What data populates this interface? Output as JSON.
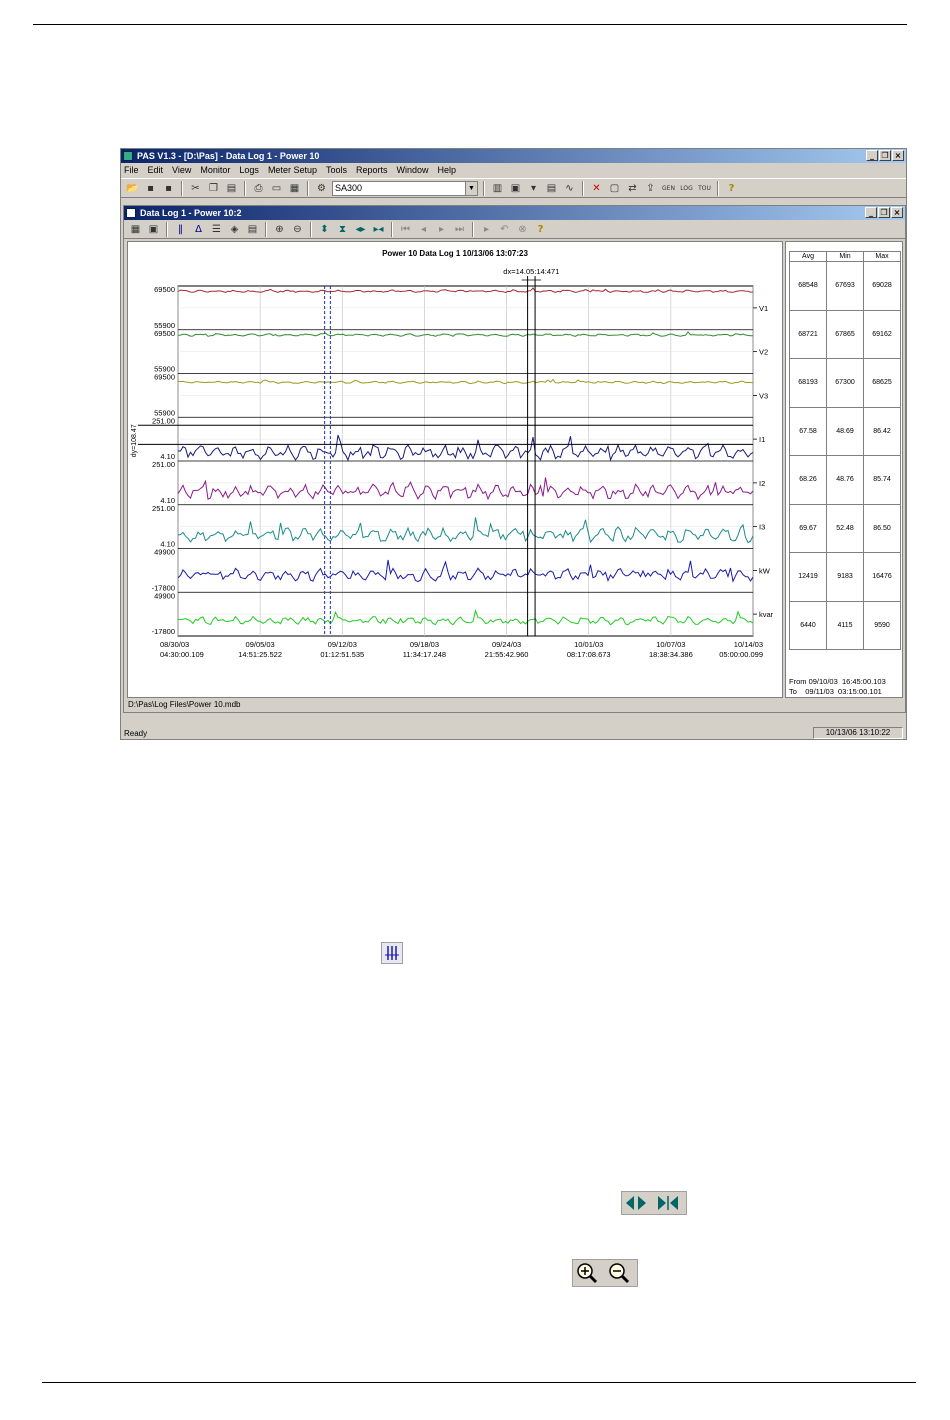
{
  "app": {
    "title": "PAS V1.3 - [D:\\Pas] - Data Log 1 - Power 10",
    "window_buttons": [
      "_",
      "❐",
      "×"
    ],
    "menu": [
      "File",
      "Edit",
      "View",
      "Monitor",
      "Logs",
      "Meter Setup",
      "Tools",
      "Reports",
      "Window",
      "Help"
    ],
    "site_combo": "SA300",
    "toolbar_icons": [
      "open-icon",
      "save-icon",
      "save-all-icon",
      "cut-icon",
      "copy-icon",
      "paste-icon",
      "print-icon",
      "preview-icon",
      "properties-icon",
      "connect-icon"
    ],
    "toolbar2_icons": [
      "table-icon",
      "monitor-icon",
      "download-icon",
      "chart-icon",
      "waveform-icon",
      "delete-icon",
      "stop-icon",
      "transfer-icon",
      "upload-icon",
      "gen-report-icon",
      "log-report-icon",
      "tou-report-icon",
      "help-icon"
    ],
    "report_labels": [
      "GEN",
      "LOG",
      "TOU"
    ],
    "status_text": "Ready",
    "status_time": "10/13/06 13:10:22"
  },
  "child": {
    "title": "Data Log 1 - Power 10:2",
    "toolbar_icons": [
      "grid-icon",
      "options-icon",
      "markers-icon",
      "delta-icon",
      "legend-icon",
      "channels-icon",
      "properties-icon",
      "zoom-in-icon",
      "zoom-out-icon",
      "expand-vertical-icon",
      "shrink-vertical-icon",
      "expand-horizontal-icon",
      "shrink-horizontal-icon",
      "first-icon",
      "prev-icon",
      "next-icon",
      "last-icon",
      "play-icon",
      "undo-icon",
      "stop-icon",
      "help-icon"
    ],
    "path": "D:\\Pas\\Log Files\\Power 10.mdb"
  },
  "chart_data": {
    "type": "line",
    "title": "Power 10  Data Log 1  10/13/06 13:07:23",
    "dx_label": "dx=14.05:14:471",
    "dy_label": "dy=108.47",
    "x_ticks": [
      {
        "date": "08/30/03",
        "time": "04:30:00.109"
      },
      {
        "date": "09/05/03",
        "time": "14:51:25.522"
      },
      {
        "date": "09/12/03",
        "time": "01:12:51.535"
      },
      {
        "date": "09/18/03",
        "time": "11:34:17.248"
      },
      {
        "date": "09/24/03",
        "time": "21:55:42.960"
      },
      {
        "date": "10/01/03",
        "time": "08:17:08.673"
      },
      {
        "date": "10/07/03",
        "time": "18:38:34.386"
      },
      {
        "date": "10/14/03",
        "time": "05:00:00.099"
      }
    ],
    "series": [
      {
        "name": "V1",
        "color": "#a52a2a",
        "ylim": [
          55900,
          69500
        ],
        "level": 0.88,
        "noise": 0.03
      },
      {
        "name": "V2",
        "color": "#2e8b2e",
        "ylim": [
          55900,
          69500
        ],
        "level": 0.88,
        "noise": 0.03
      },
      {
        "name": "V3",
        "color": "#9a9a1a",
        "ylim": [
          55900,
          69500
        ],
        "level": 0.8,
        "noise": 0.03
      },
      {
        "name": "I1",
        "color": "#1a1a7a",
        "ylim": [
          4.1,
          251.0
        ],
        "level": 0.2,
        "noise": 0.18
      },
      {
        "name": "I2",
        "color": "#8b1a8b",
        "ylim": [
          4.1,
          251.0
        ],
        "level": 0.3,
        "noise": 0.18
      },
      {
        "name": "I3",
        "color": "#1a8b8b",
        "ylim": [
          4.1,
          251.0
        ],
        "level": 0.3,
        "noise": 0.18
      },
      {
        "name": "kW",
        "color": "#1a1aaa",
        "ylim": [
          -17800,
          49900
        ],
        "level": 0.4,
        "noise": 0.16
      },
      {
        "name": "kvar",
        "color": "#22cc22",
        "ylim": [
          -17800,
          49900
        ],
        "level": 0.35,
        "noise": 0.1
      }
    ],
    "y_tick_labels": [
      [
        "69500",
        "55900"
      ],
      [
        "69500",
        "55900"
      ],
      [
        "69500",
        "55900"
      ],
      [
        "251.00",
        "4.10"
      ],
      [
        "251.00",
        "4.10"
      ],
      [
        "251.00",
        "4.10"
      ],
      [
        "49900",
        "-17800"
      ],
      [
        "49900",
        "-17800"
      ]
    ]
  },
  "stats": {
    "headers": [
      "Avg",
      "Min",
      "Max"
    ],
    "rows": [
      [
        "68548",
        "67693",
        "69028"
      ],
      [
        "68721",
        "67865",
        "69162"
      ],
      [
        "68193",
        "67300",
        "68625"
      ],
      [
        "67.58",
        "48.69",
        "86.42"
      ],
      [
        "68.26",
        "48.76",
        "85.74"
      ],
      [
        "69.67",
        "52.48",
        "86.50"
      ],
      [
        "12419",
        "9183",
        "16476"
      ],
      [
        "6440",
        "4115",
        "9590"
      ]
    ],
    "from": "From 09/10/03  16:45:00.103",
    "to": "To    09/11/03  03:15:00.101"
  }
}
